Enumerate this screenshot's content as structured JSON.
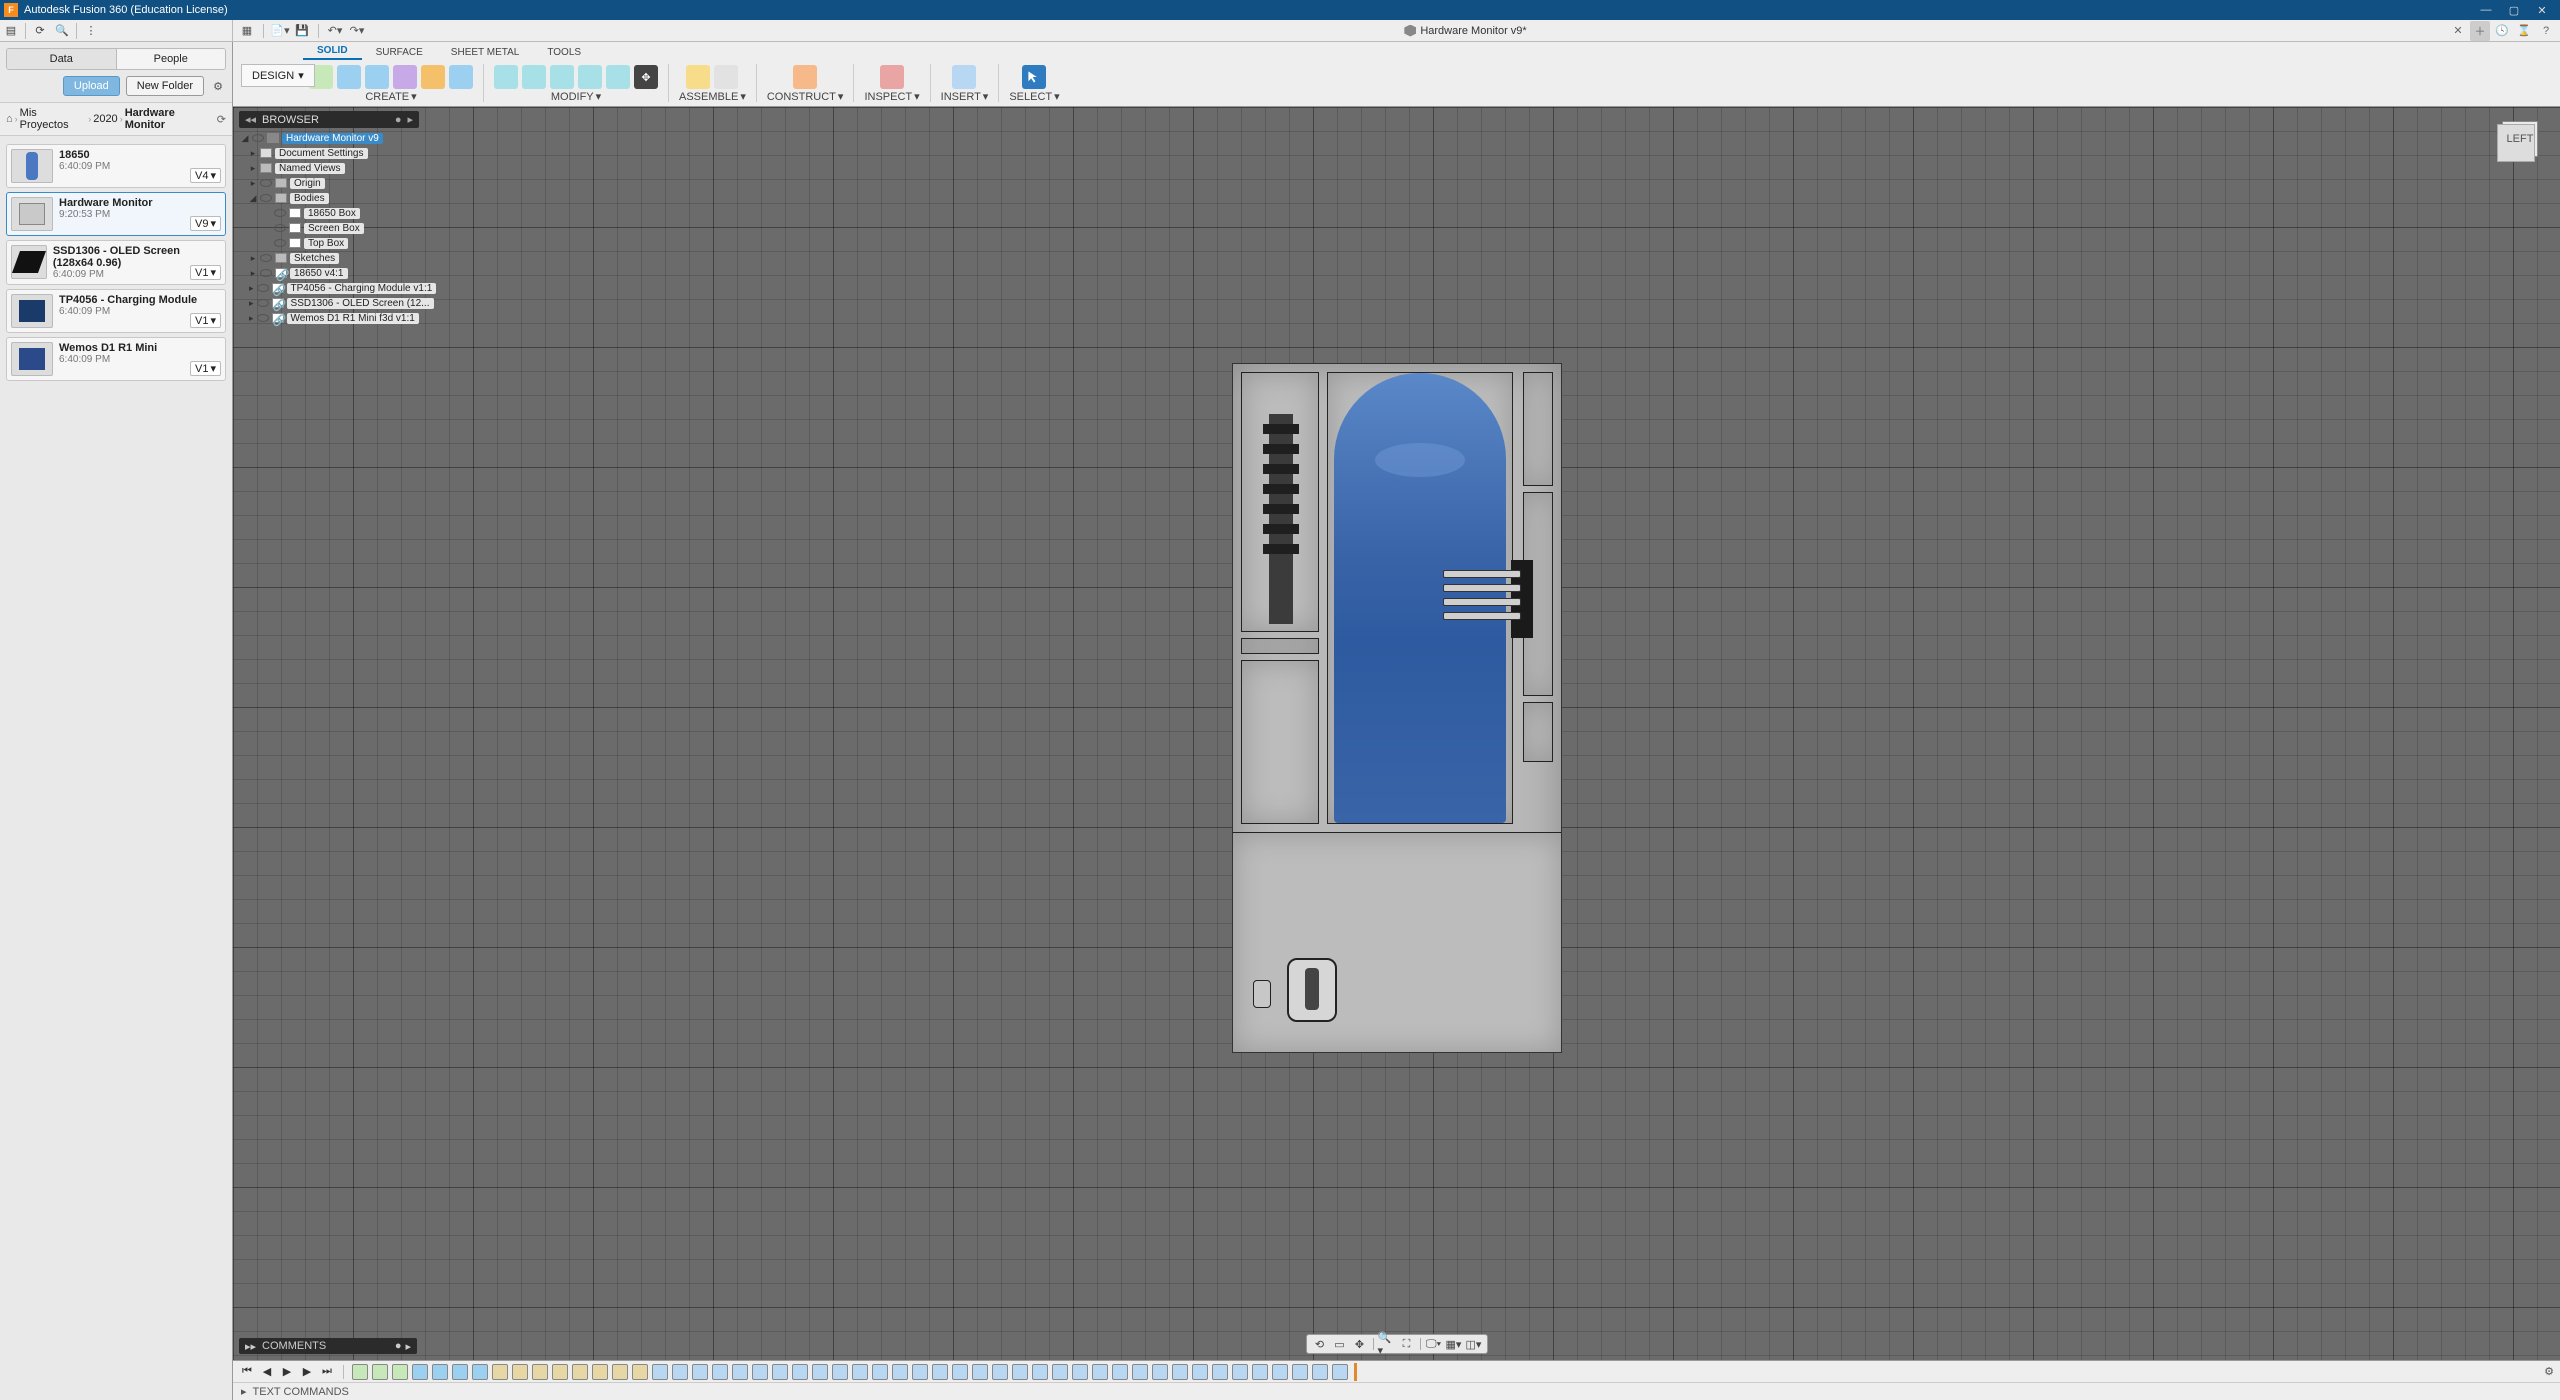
{
  "app": {
    "title": "Autodesk Fusion 360 (Education License)"
  },
  "doc": {
    "name": "Hardware Monitor v9*"
  },
  "datapanel": {
    "tabs": {
      "data": "Data",
      "people": "People"
    },
    "buttons": {
      "upload": "Upload",
      "new_folder": "New Folder"
    },
    "breadcrumbs": {
      "root": "Mis Proyectos",
      "year": "2020",
      "current": "Hardware Monitor"
    },
    "items": [
      {
        "name": "18650",
        "time": "6:40:09 PM",
        "ver": "V4"
      },
      {
        "name": "Hardware Monitor",
        "time": "9:20:53 PM",
        "ver": "V9"
      },
      {
        "name": "SSD1306 - OLED Screen (128x64 0.96)",
        "time": "6:40:09 PM",
        "ver": "V1"
      },
      {
        "name": "TP4056 - Charging Module",
        "time": "6:40:09 PM",
        "ver": "V1"
      },
      {
        "name": "Wemos D1 R1 Mini",
        "time": "6:40:09 PM",
        "ver": "V1"
      }
    ]
  },
  "ribbon": {
    "workspace": "DESIGN",
    "tabs": {
      "solid": "SOLID",
      "surface": "SURFACE",
      "sheet": "SHEET METAL",
      "tools": "TOOLS"
    },
    "groups": {
      "create": "CREATE",
      "modify": "MODIFY",
      "assemble": "ASSEMBLE",
      "construct": "CONSTRUCT",
      "inspect": "INSPECT",
      "insert": "INSERT",
      "select": "SELECT"
    }
  },
  "browser": {
    "title": "BROWSER",
    "root": "Hardware Monitor v9",
    "nodes": {
      "doc_settings": "Document Settings",
      "named_views": "Named Views",
      "origin": "Origin",
      "bodies": "Bodies",
      "body_18650": "18650 Box",
      "body_screen": "Screen Box",
      "body_top": "Top Box",
      "sketches": "Sketches",
      "c_18650": "18650 v4:1",
      "c_tp": "TP4056 - Charging Module v1:1",
      "c_ssd": "SSD1306 - OLED Screen (12...",
      "c_wemos": "Wemos D1 R1 Mini f3d v1:1"
    }
  },
  "viewcube": {
    "face": "LEFT"
  },
  "bottom": {
    "comments": "COMMENTS",
    "textcmd": "TEXT COMMANDS"
  }
}
